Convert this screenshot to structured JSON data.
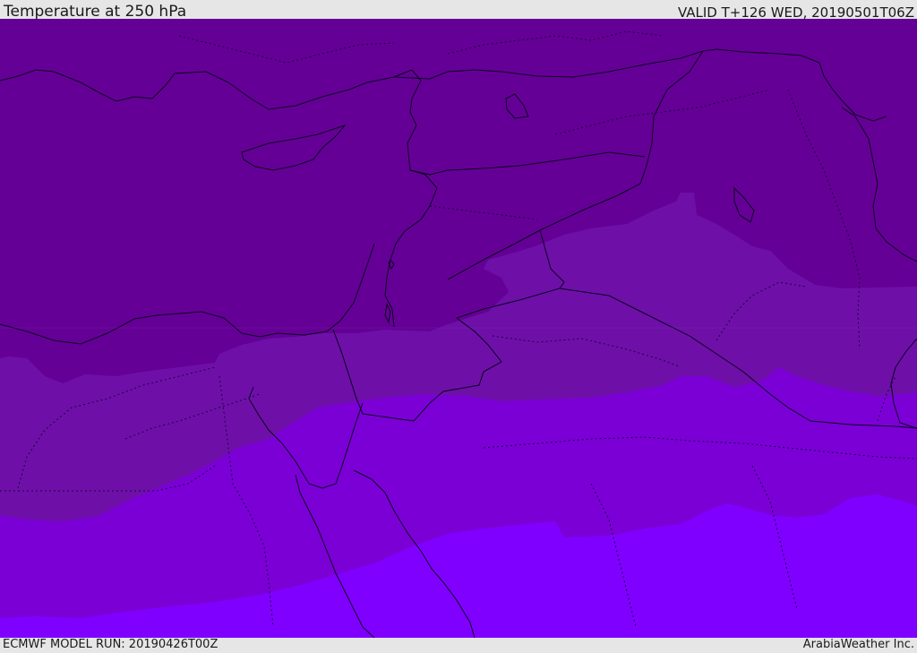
{
  "header": {
    "title": "Temperature at 250 hPa",
    "valid": "VALID T+126 WED, 20190501T06Z"
  },
  "footer": {
    "model_run": "ECMWF MODEL RUN: 20190426T00Z",
    "credit": "ArabiaWeather Inc."
  },
  "map": {
    "field": "temperature",
    "level": "250 hPa",
    "palette": [
      "#5e008c",
      "#650096",
      "#6e10a8",
      "#7b00d6",
      "#8000ff"
    ],
    "coastline_color": "#0a0020",
    "border_color": "#0a0020"
  }
}
